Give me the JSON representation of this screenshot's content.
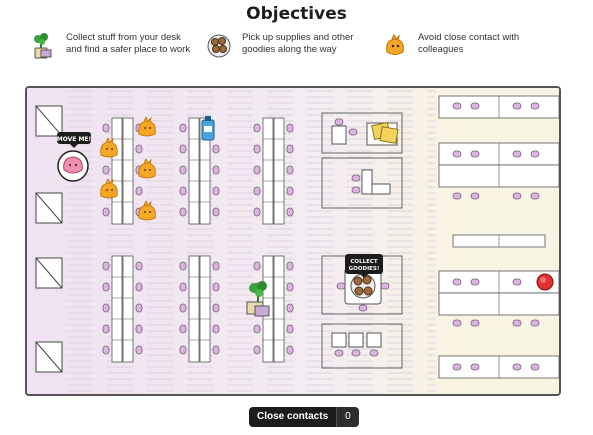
{
  "header": {
    "title": "Objectives"
  },
  "objectives": [
    {
      "icon": "plant-desk-items-icon",
      "text": "Collect stuff from your desk and find a safer place to work"
    },
    {
      "icon": "cookie-plate-icon",
      "text": "Pick up supplies and other goodies along the way"
    },
    {
      "icon": "orange-colleague-icon",
      "text": "Avoid close contact with colleagues"
    }
  ],
  "board": {
    "player_bubble": "MOVE ME!",
    "goodies_bubble_line1": "COLLECT",
    "goodies_bubble_line2": "GOODIES!"
  },
  "status": {
    "close_contacts_label": "Close contacts",
    "close_contacts_value": "0"
  },
  "colors": {
    "background_left": "#f1e6f2",
    "background_right": "#f7f3e1",
    "chair": "#d9b6dc",
    "colleague": "#f5a623",
    "player": "#f08fb2",
    "exit": "#e03030"
  }
}
